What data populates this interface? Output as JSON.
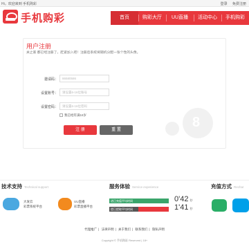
{
  "topbar": {
    "welcome": "Hi，欢迎来到 手机购彩",
    "links": [
      "登录",
      "免费注册"
    ]
  },
  "header": {
    "logo_text": "手机购彩",
    "nav": [
      "首页",
      "购彩大厅",
      "UU直播",
      "活动中心",
      "手机购彩"
    ]
  },
  "register": {
    "title": "用户注册",
    "desc": "关之家 都已经注册了，赶紧加入吧！注册后系统将随机分配一张个性的头像。",
    "fields": [
      {
        "label": "邀请码：",
        "value": "",
        "placeholder": "86580586"
      },
      {
        "label": "设置账号：",
        "value": "",
        "placeholder": "请设置6-16位账号"
      },
      {
        "label": "设置密码：",
        "value": "",
        "placeholder": "请设置6-16位密码"
      }
    ],
    "agree_text": "我已经年满18岁",
    "submit_label": "注 册",
    "reset_label": "重 置"
  },
  "support": {
    "title": "技术支持",
    "title_en": "Technical support",
    "partners": [
      {
        "name": "大发云",
        "desc": "彩票系统平台",
        "color": "#4aa8e0"
      },
      {
        "name": "UU直播",
        "desc": "彩票直播平台",
        "color": "#f28a1e"
      }
    ]
  },
  "service": {
    "title": "服务体验",
    "title_en": "Service experience",
    "items": [
      {
        "label": "进已充值平均时间",
        "value": "0'42",
        "unit": "秒",
        "color": "#3aa56b",
        "fill": 0.45
      },
      {
        "label": "提已提取平均时间",
        "value": "1'41",
        "unit": "秒",
        "color": "#e8383d",
        "fill": 0.2
      }
    ]
  },
  "payment": {
    "title": "充值方式",
    "title_en": "Rechar",
    "methods": [
      {
        "name": "wechat-pay-icon",
        "color": "#2aae67"
      },
      {
        "name": "alipay-icon",
        "color": "#00a0e9"
      }
    ]
  },
  "footer": {
    "links": [
      "代理推广",
      "法律声明",
      "关于我们",
      "联系我们",
      "隐私声明"
    ],
    "copyright": "Copyright © 手机购彩 Reserved | 18+"
  }
}
